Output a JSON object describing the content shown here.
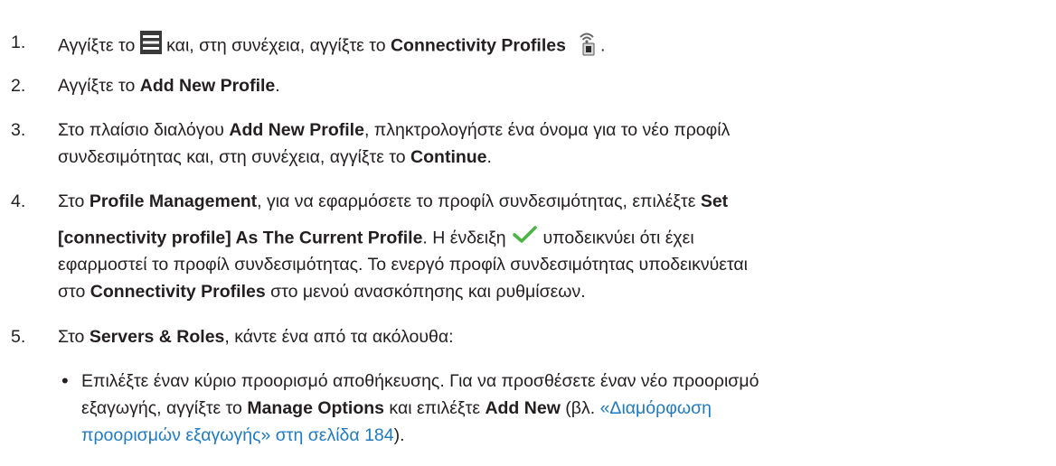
{
  "steps": [
    {
      "number": "1.",
      "lines": [
        {
          "t1": "Αγγίξτε το ",
          "icon1": "hamburger-menu-icon",
          "t2": " και, στη συνέχεια, αγγίξτε το ",
          "b1": "Connectivity Profiles",
          "icon2": "connectivity-profiles-icon",
          "t3": "."
        }
      ]
    },
    {
      "number": "2.",
      "lines": [
        {
          "t1": "Αγγίξτε το ",
          "b1": "Add New Profile",
          "t2": "."
        }
      ]
    },
    {
      "number": "3.",
      "lines": [
        {
          "t1": "Στο πλαίσιο διαλόγου ",
          "b1": "Add New Profile",
          "t2": ", πληκτρολογήστε ένα όνομα για το νέο προφίλ"
        },
        {
          "t1": "συνδεσιμότητας και, στη συνέχεια, αγγίξτε το ",
          "b1": "Continue",
          "t2": "."
        }
      ]
    },
    {
      "number": "4.",
      "lines": [
        {
          "t1": "Στο ",
          "b1": "Profile Management",
          "t2": ", για να εφαρμόσετε το προφίλ συνδεσιμότητας, επιλέξτε ",
          "b2": "Set"
        },
        {
          "b1": "[connectivity profile] As The Current Profile",
          "t1": ". Η ένδειξη ",
          "icon1": "checkmark-icon",
          "t2": " υποδεικνύει ότι έχει"
        },
        {
          "t1": "εφαρμοστεί το προφίλ συνδεσιμότητας. Το ενεργό προφίλ συνδεσιμότητας υποδεικνύεται"
        },
        {
          "t1": "στο ",
          "b1": "Connectivity Profiles",
          "t2": " στο μενού ανασκόπησης και ρυθμίσεων."
        }
      ]
    },
    {
      "number": "5.",
      "lines": [
        {
          "t1": "Στο ",
          "b1": "Servers & Roles",
          "t2": ", κάντε ένα από τα ακόλουθα:"
        }
      ]
    }
  ],
  "bullet_item": {
    "symbol": "•",
    "lines": [
      {
        "t1": "Επιλέξτε έναν κύριο προορισμό αποθήκευσης. Για να προσθέσετε έναν νέο προορισμό"
      },
      {
        "t1": "εξαγωγής, αγγίξτε το ",
        "b1": "Manage Options",
        "t2": " και επιλέξτε ",
        "b2": "Add New",
        "t3": " (βλ. ",
        "link1": "«Διαμόρφωση"
      },
      {
        "link1": "προορισμών εξαγωγής» στη σελίδα 184",
        "t1": ")."
      }
    ]
  },
  "colors": {
    "text": "#231f20",
    "link": "#1f7ac1",
    "check": "#4bb543"
  }
}
